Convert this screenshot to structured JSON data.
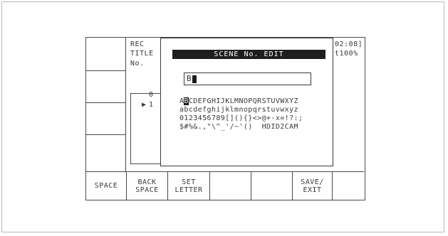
{
  "header": {
    "rec_label": "REC",
    "title_label": "TITLE",
    "no_label": "No.",
    "timecode_fragment": "02:08]",
    "speed_fragment": "t100%"
  },
  "list": {
    "rows": [
      {
        "marker": "",
        "index": "0"
      },
      {
        "marker": "▶",
        "index": "1"
      }
    ]
  },
  "dialog": {
    "title": "SCENE No. EDIT",
    "name_value": "B",
    "charset_rows": [
      "ABCDEFGHIJKLMNOPQRSTUVWXYZ",
      "abcdefghijklmnopqrstuvwxyz",
      "0123456789[](){}<>@+-x=!?:;",
      "$#%&.,\"\\^_'/~'()  HDID2CAM"
    ],
    "selected_char": "B"
  },
  "fkeys": [
    "SPACE",
    "BACK\nSPACE",
    "SET\nLETTER",
    "",
    "",
    "SAVE/\nEXIT",
    ""
  ]
}
